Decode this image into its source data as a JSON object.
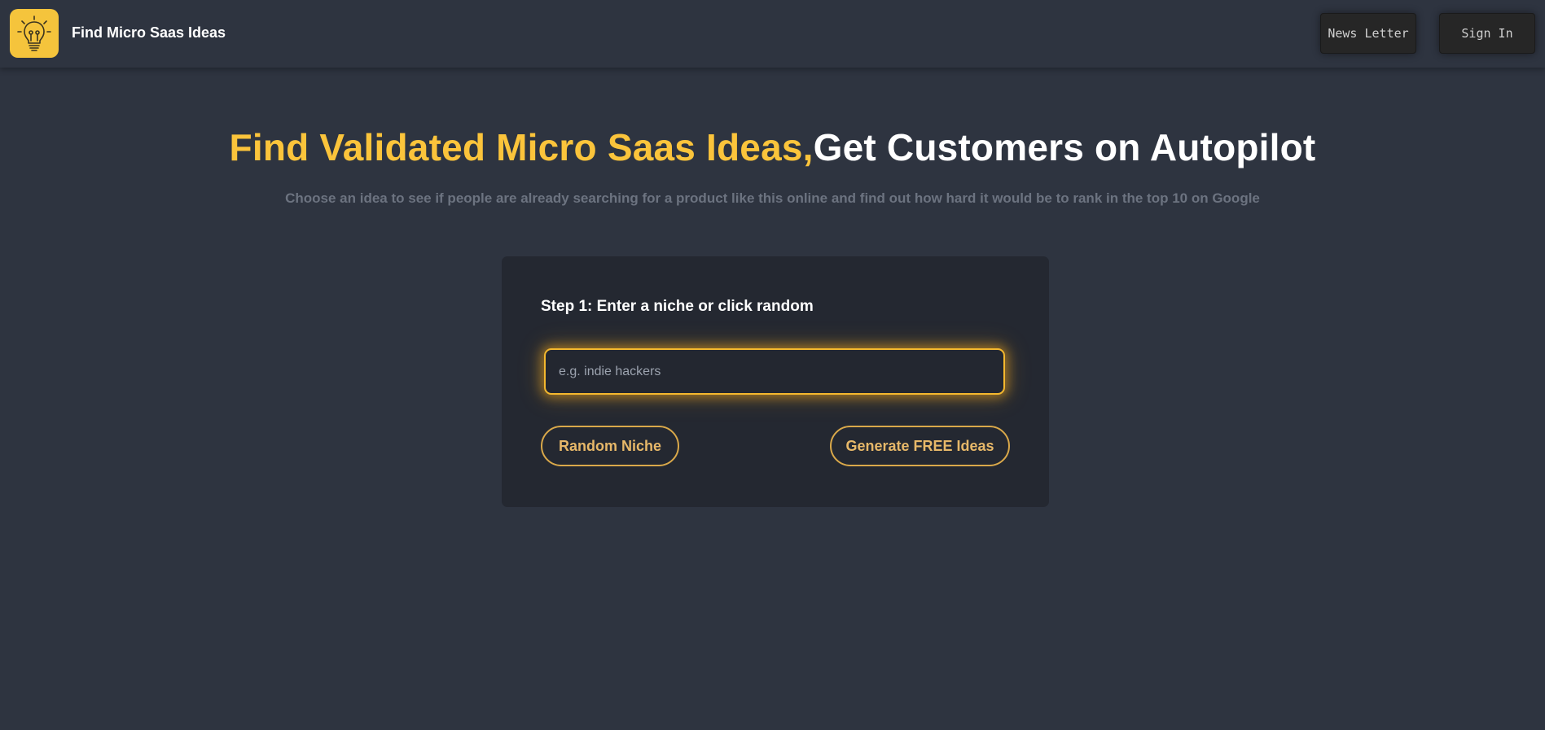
{
  "header": {
    "brand": "Find Micro Saas Ideas",
    "logo_icon": "lightbulb-icon",
    "newsletter_label": "News Letter",
    "signin_label": "Sign In"
  },
  "hero": {
    "headline_accent": "Find Validated Micro Saas Ideas,",
    "headline_rest": "Get Customers on Autopilot",
    "subtitle": "Choose an idea to see if people are already searching for a product like this online and find out how hard it would be to rank in the top 10 on Google"
  },
  "card": {
    "step_label": "Step 1: Enter a niche or click random",
    "input_placeholder": "e.g. indie hackers",
    "input_value": "",
    "random_label": "Random Niche",
    "generate_label": "Generate FREE Ideas"
  },
  "colors": {
    "background": "#2e3440",
    "accent": "#fbc43b",
    "card": "#242831",
    "button_outline": "#d9a84a"
  }
}
